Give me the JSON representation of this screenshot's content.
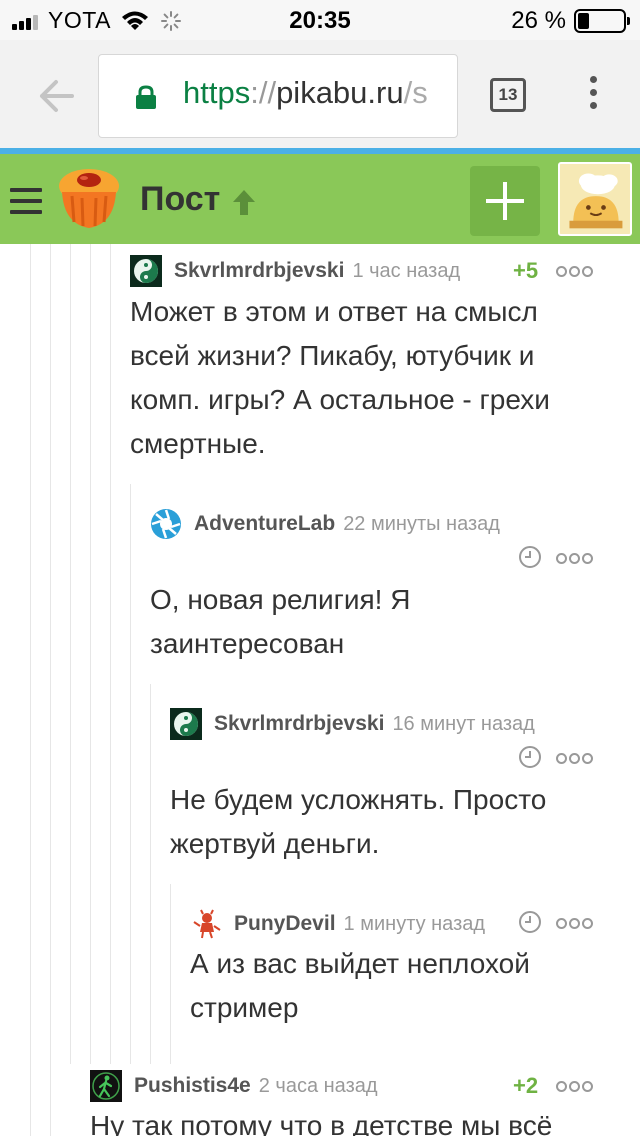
{
  "status_bar": {
    "carrier": "YOTA",
    "time": "20:35",
    "battery_text": "26 %",
    "battery_level": 0.26
  },
  "browser": {
    "url_scheme": "https",
    "url_sep": "://",
    "url_host": "pikabu.ru",
    "url_path": "/s",
    "tab_count": "13"
  },
  "header": {
    "title": "Пост"
  },
  "comments": [
    {
      "user": "Skvrlmrdrbjevski",
      "time": "1 час назад",
      "rating": "+5",
      "text": "Может в этом и ответ на смысл всей жизни? Пикабу, ютубчик и комп. игры? А остальное - грехи смертные."
    },
    {
      "user": "AdventureLab",
      "time": "22 минуты назад",
      "text": "О, новая религия! Я заинтересован"
    },
    {
      "user": "Skvrlmrdrbjevski",
      "time": "16 минут назад",
      "text": "Не будем усложнять. Просто жертвуй деньги."
    },
    {
      "user": "PunyDevil",
      "time": "1 минуту назад",
      "text": "А из вас выйдет неплохой стример"
    },
    {
      "user": "Pushistis4e",
      "time": "2 часа назад",
      "rating": "+2",
      "text": "Ну так потому что в детстве мы всё"
    }
  ],
  "icons": {
    "back": "back-arrow-icon",
    "lock": "lock-icon",
    "menu": "more-vertical-icon",
    "hamburger": "hamburger-menu-icon",
    "add": "plus-icon",
    "clock": "clock-icon",
    "more": "more-horizontal-icon"
  },
  "colors": {
    "header_green": "#8ac858",
    "header_top_border": "#4bb0e6",
    "rating_green": "#6fb243",
    "url_scheme_green": "#0b8043"
  }
}
